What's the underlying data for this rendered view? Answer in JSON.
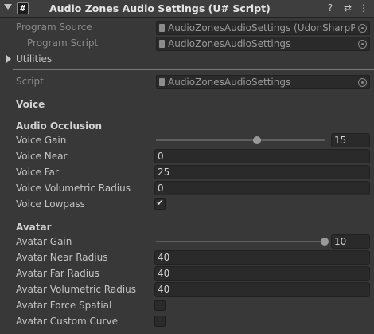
{
  "header": {
    "title": "Audio Zones Audio Settings (U# Script)",
    "script_icon_glyph": "#",
    "help_icon": "?",
    "settings_icon": "⇄",
    "menu_icon": "⋮"
  },
  "program": {
    "source_label": "Program Source",
    "source_value": "AudioZonesAudioSettings (UdonSharpProg",
    "script_label": "Program Script",
    "script_value": "AudioZonesAudioSettings"
  },
  "utilities": {
    "label": "Utilities"
  },
  "script": {
    "label": "Script",
    "value": "AudioZonesAudioSettings"
  },
  "voice": {
    "section": "Voice",
    "subsection": "Audio Occlusion",
    "gain": {
      "label": "Voice Gain",
      "value": "15",
      "fraction": 0.6
    },
    "near": {
      "label": "Voice Near",
      "value": "0"
    },
    "far": {
      "label": "Voice Far",
      "value": "25"
    },
    "volumetric": {
      "label": "Voice Volumetric Radius",
      "value": "0"
    },
    "lowpass": {
      "label": "Voice Lowpass",
      "checked": true,
      "check_glyph": "✔"
    }
  },
  "avatar": {
    "section": "Avatar",
    "gain": {
      "label": "Avatar Gain",
      "value": "10",
      "fraction": 1.0
    },
    "near": {
      "label": "Avatar Near Radius",
      "value": "40"
    },
    "far": {
      "label": "Avatar Far Radius",
      "value": "40"
    },
    "volumetric": {
      "label": "Avatar Volumetric Radius",
      "value": "40"
    },
    "force_spatial": {
      "label": "Avatar Force Spatial",
      "checked": false
    },
    "custom_curve": {
      "label": "Avatar Custom Curve",
      "checked": false
    }
  }
}
